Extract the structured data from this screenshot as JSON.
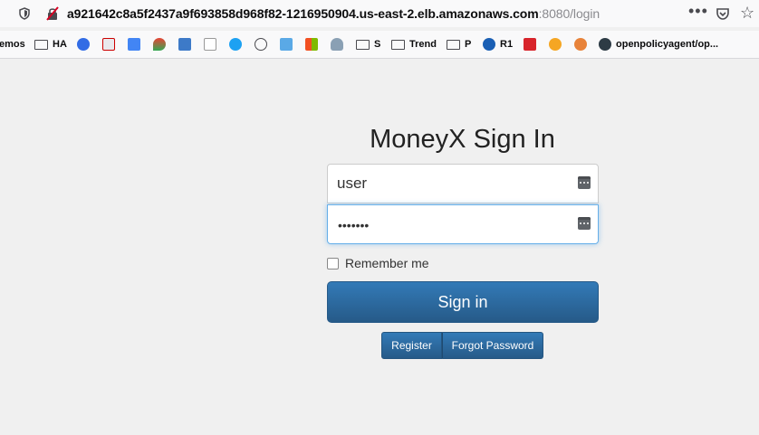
{
  "browser": {
    "url_host": "a921642c8a5f2437a9f693858d968f82-1216950904.us-east-2.elb.amazonaws.com",
    "url_rest": ":8080/login",
    "more_glyph": "•••",
    "star_glyph": "☆"
  },
  "bookmarks": [
    {
      "label": "emos"
    },
    {
      "label": "HA"
    },
    {
      "label": "S"
    },
    {
      "label": "Trend"
    },
    {
      "label": "P"
    },
    {
      "label": "R1"
    },
    {
      "label": "openpolicyagent/op..."
    }
  ],
  "login": {
    "title": "MoneyX Sign In",
    "username_value": "user",
    "password_mask": "•••••••",
    "remember_label": "Remember me",
    "signin_label": "Sign in",
    "register_label": "Register",
    "forgot_label": "Forgot Password"
  },
  "colors": {
    "primary": "#337ab7",
    "primary_dark": "#265a88",
    "focus": "#66afe9",
    "background": "#f0f0f0"
  }
}
